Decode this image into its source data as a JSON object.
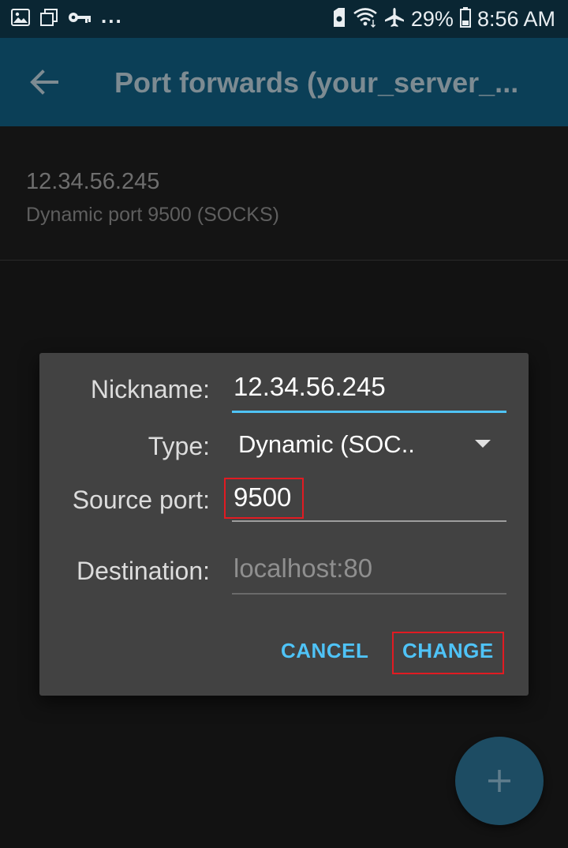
{
  "status_bar": {
    "overflow_dots": "...",
    "battery_pct": "29%",
    "time": "8:56 AM",
    "icons_left": [
      "image-icon",
      "copy-icon",
      "key-icon"
    ],
    "icons_right": [
      "sim-icon",
      "wifi-icon",
      "airplane-icon",
      "battery-icon"
    ]
  },
  "app_bar": {
    "title": "Port forwards (your_server_..."
  },
  "list": {
    "items": [
      {
        "title": "12.34.56.245",
        "subtitle": "Dynamic port 9500 (SOCKS)"
      }
    ]
  },
  "dialog": {
    "nickname_label": "Nickname:",
    "nickname_value": "12.34.56.245",
    "type_label": "Type:",
    "type_value": "Dynamic (SOC..",
    "source_port_label": "Source port:",
    "source_port_value": "9500",
    "destination_label": "Destination:",
    "destination_placeholder": "localhost:80",
    "cancel_label": "CANCEL",
    "change_label": "CHANGE"
  },
  "colors": {
    "accent": "#4fc3f7",
    "app_bar": "#0b3f57",
    "highlight": "#e11b22",
    "fab": "#1d4c63"
  }
}
